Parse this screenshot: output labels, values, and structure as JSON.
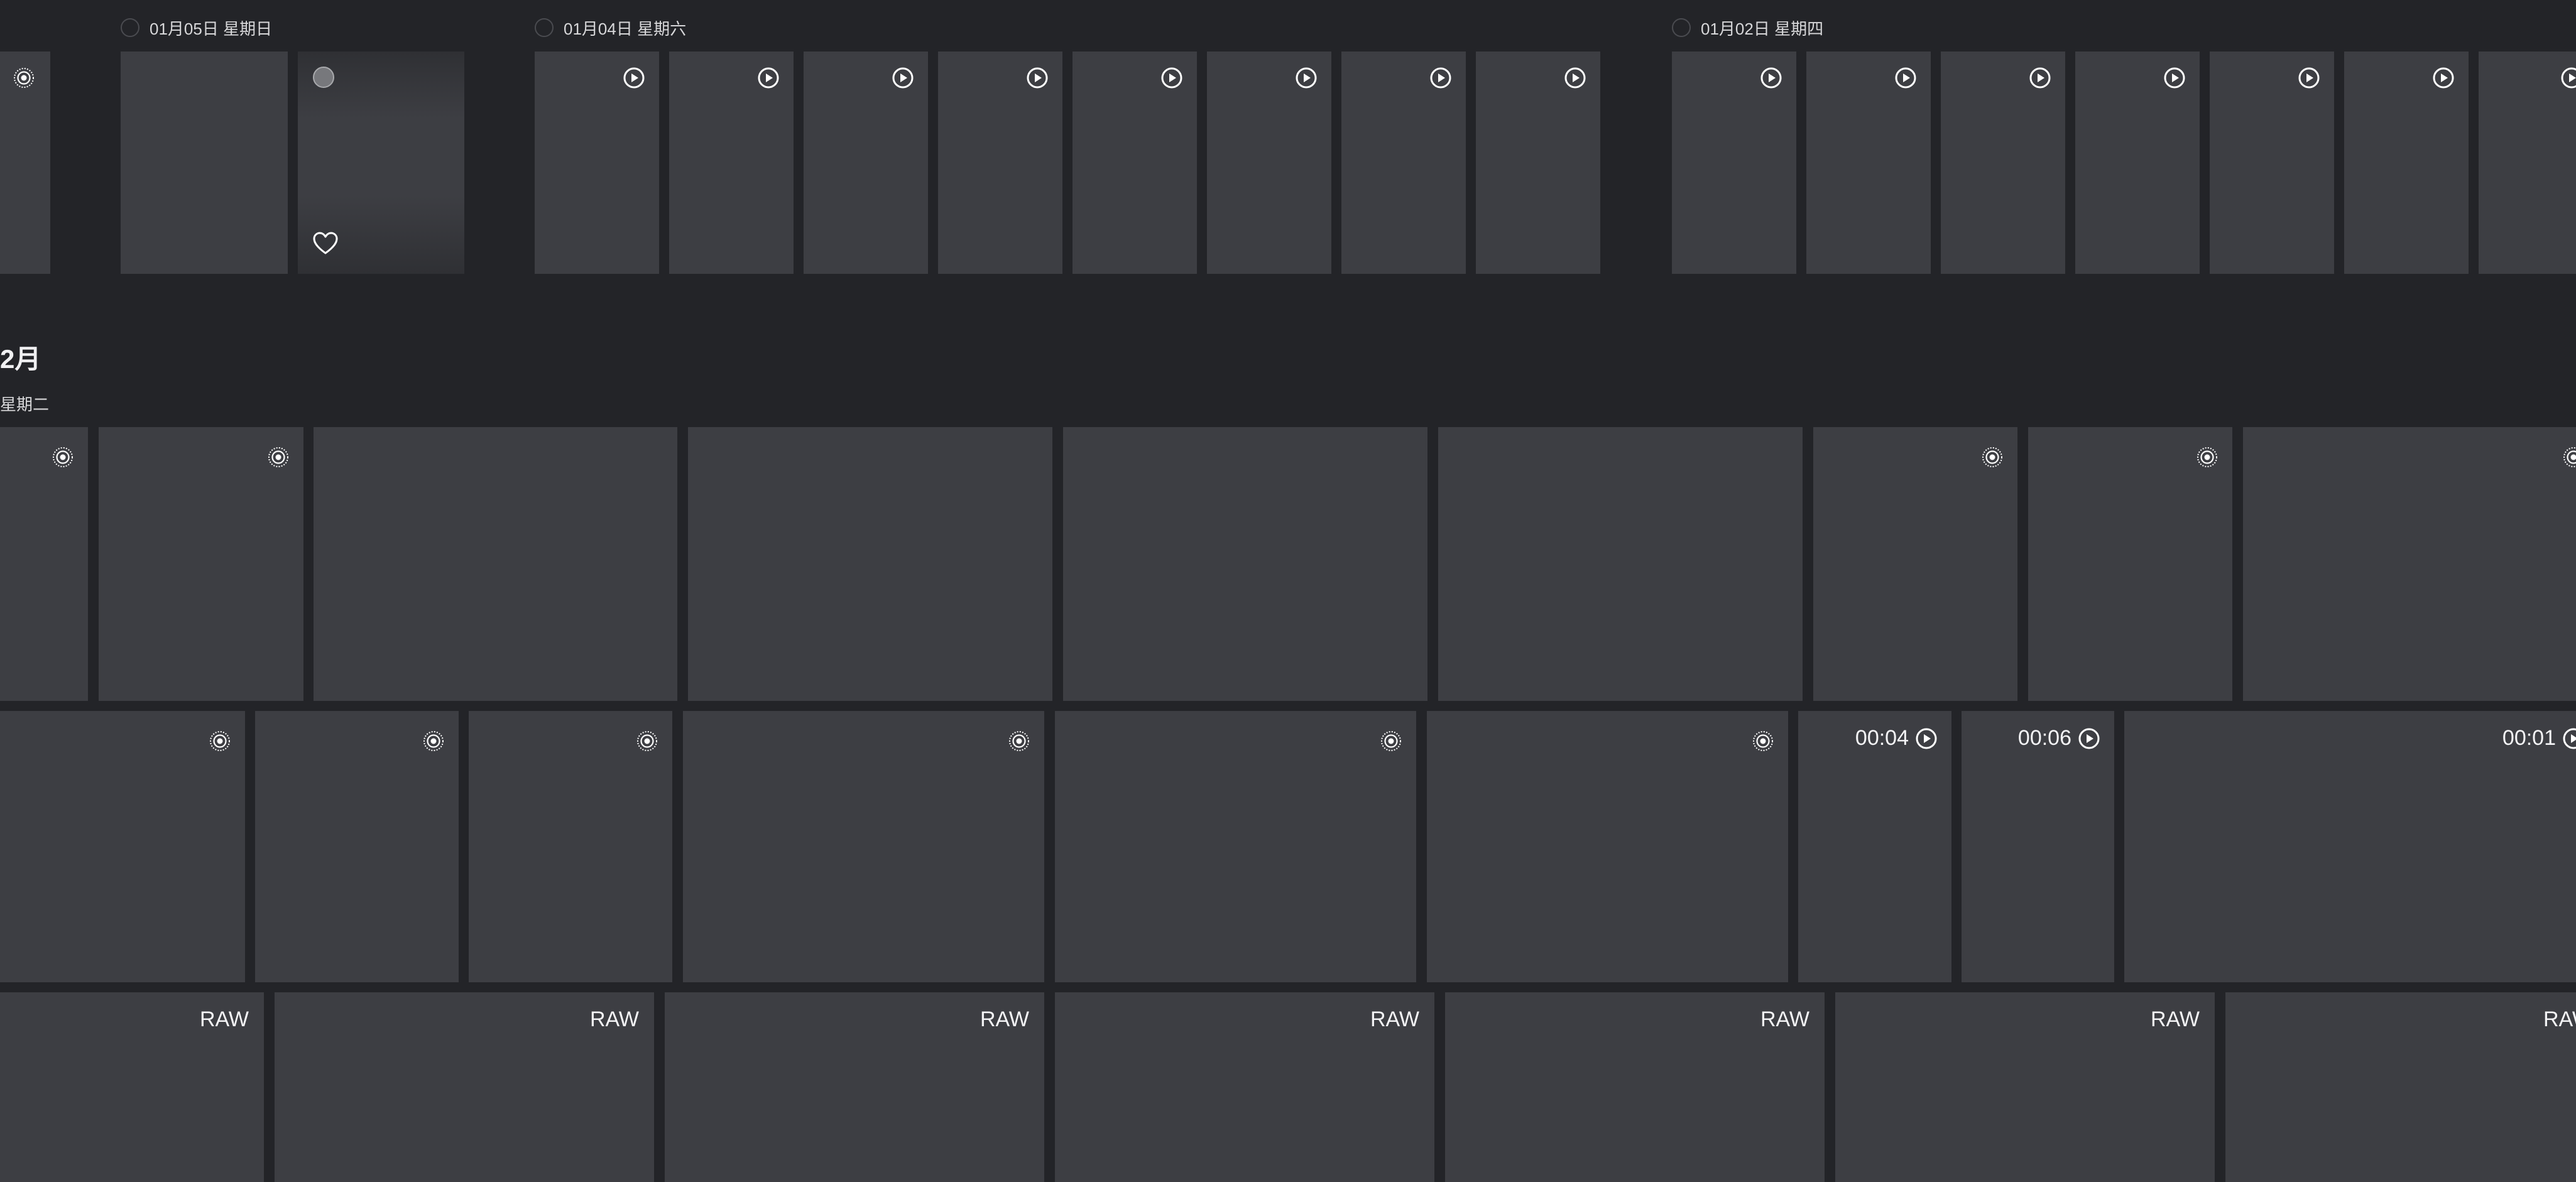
{
  "groups": [
    {
      "date_label": "01月05日 星期日"
    },
    {
      "date_label": "01月04日 星期六"
    },
    {
      "date_label": "01月02日 星期四"
    }
  ],
  "month": {
    "title": "2月",
    "weekday": "星期二"
  },
  "durations": [
    "00:04",
    "00:06",
    "00:01"
  ],
  "raw_label": "RAW",
  "icons": {
    "live": "live-photo-icon",
    "play": "play-icon",
    "favorite": "heart-icon",
    "select": "select-circle-icon"
  },
  "colors": {
    "background": "#232428",
    "tile": "#3d3e43",
    "text": "#e6e6e8"
  }
}
